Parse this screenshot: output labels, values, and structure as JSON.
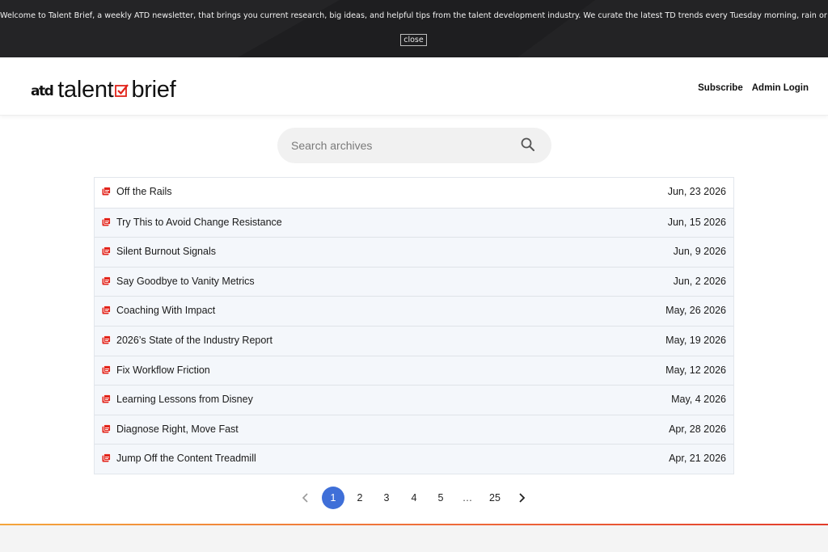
{
  "banner": {
    "message": "Welcome to Talent Brief, a weekly ATD newsletter, that brings you current research, big ideas, and helpful tips from the talent development industry. We curate the latest TD trends every Tuesday morning, rain or shine.",
    "close_label": "close"
  },
  "header": {
    "logo": {
      "prefix": "atd",
      "word1": "talent",
      "word2": "brief",
      "check_color": "#e2231a"
    },
    "nav": {
      "subscribe": "Subscribe",
      "admin_login": "Admin Login"
    }
  },
  "search": {
    "placeholder": "Search archives",
    "value": "",
    "icon": "search-icon"
  },
  "archive": {
    "icon": "newsletter-icon",
    "items": [
      {
        "title": "Off the Rails",
        "date": "Jun, 23 2026"
      },
      {
        "title": "Try This to Avoid Change Resistance",
        "date": "Jun, 15 2026"
      },
      {
        "title": "Silent Burnout Signals",
        "date": "Jun, 9 2026"
      },
      {
        "title": "Say Goodbye to Vanity Metrics",
        "date": "Jun, 2 2026"
      },
      {
        "title": "Coaching With Impact",
        "date": "May, 26 2026"
      },
      {
        "title": "2026’s State of the Industry Report",
        "date": "May, 19 2026"
      },
      {
        "title": "Fix Workflow Friction",
        "date": "May, 12 2026"
      },
      {
        "title": "Learning Lessons from Disney",
        "date": "May, 4 2026"
      },
      {
        "title": "Diagnose Right, Move Fast",
        "date": "Apr, 28 2026"
      },
      {
        "title": "Jump Off the Content Treadmill",
        "date": "Apr, 21 2026"
      }
    ]
  },
  "pagination": {
    "pages": [
      "1",
      "2",
      "3",
      "4",
      "5",
      "…",
      "25"
    ],
    "current": "1",
    "active_color": "#3f6fd8"
  },
  "colors": {
    "accent_red": "#e2231a",
    "footer_gradient": [
      "#f4a53b",
      "#e23c2b"
    ]
  }
}
